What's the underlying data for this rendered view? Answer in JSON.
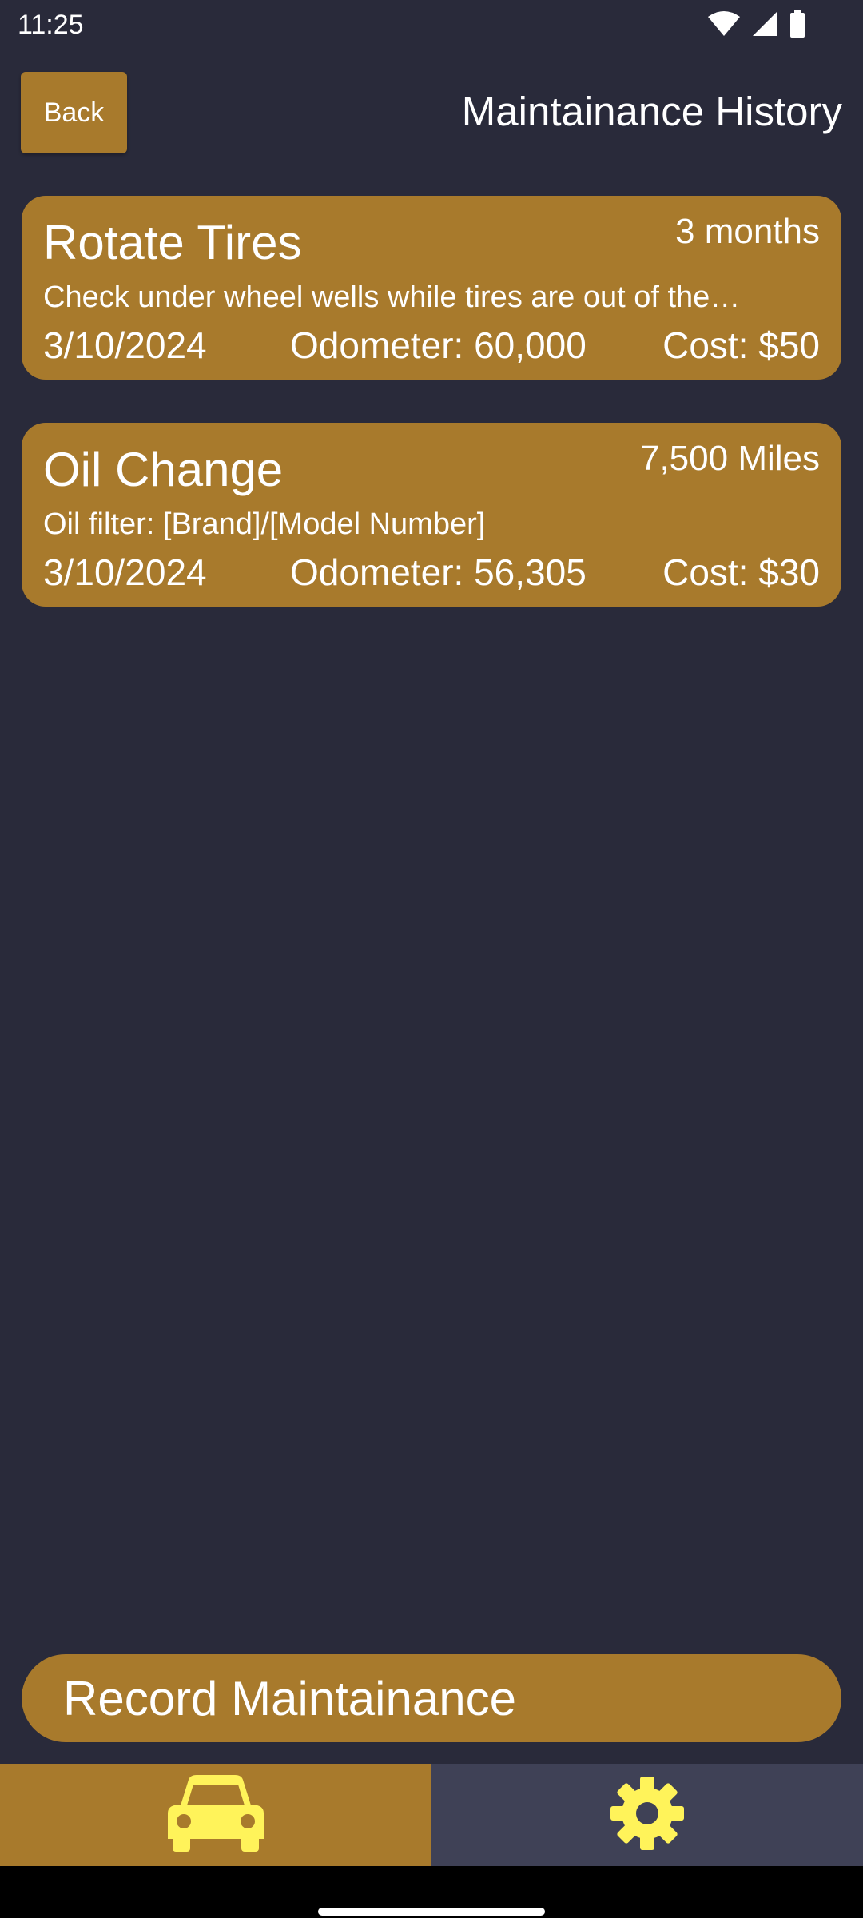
{
  "status_bar": {
    "time": "11:25"
  },
  "header": {
    "back_label": "Back",
    "title": "Maintainance History"
  },
  "records": [
    {
      "title": "Rotate Tires",
      "interval": "3 months",
      "note": "Check under wheel wells while tires are out of the…",
      "date": "3/10/2024",
      "odometer": "Odometer: 60,000",
      "cost": "Cost: $50"
    },
    {
      "title": "Oil Change",
      "interval": "7,500 Miles",
      "note": "Oil filter: [Brand]/[Model Number]",
      "date": "3/10/2024",
      "odometer": "Odometer: 56,305",
      "cost": "Cost: $30"
    }
  ],
  "actions": {
    "record_label": "Record Maintainance"
  },
  "bottom_nav": {
    "items": [
      {
        "icon": "car-icon",
        "active": true
      },
      {
        "icon": "gear-icon",
        "active": false
      }
    ]
  },
  "colors": {
    "background": "#292a3a",
    "accent": "#a87a2c",
    "icon": "#fff35a",
    "nav_inactive": "#3f4156"
  }
}
